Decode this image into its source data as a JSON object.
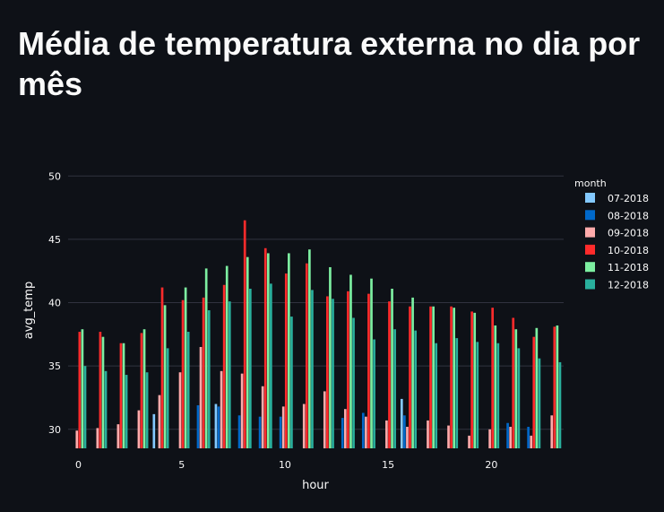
{
  "page": {
    "title": "Média de temperatura externa no dia por mês"
  },
  "chart_data": {
    "type": "bar",
    "xlabel": "hour",
    "ylabel": "avg_temp",
    "xlim": [
      -0.5,
      23.5
    ],
    "ylim": [
      28.5,
      52
    ],
    "x_ticks": [
      0,
      5,
      10,
      15,
      20
    ],
    "y_ticks": [
      30,
      35,
      40,
      45,
      50
    ],
    "grid": true,
    "legend_title": "month",
    "legend_position": "right",
    "x": [
      0,
      1,
      2,
      3,
      4,
      5,
      6,
      7,
      8,
      9,
      10,
      11,
      12,
      13,
      14,
      15,
      16,
      17,
      18,
      19,
      20,
      21,
      22,
      23
    ],
    "series": [
      {
        "name": "07-2018",
        "color": "#83c9ff",
        "values": [
          null,
          null,
          null,
          null,
          31.2,
          null,
          null,
          32.0,
          null,
          null,
          null,
          null,
          null,
          null,
          null,
          null,
          32.4,
          null,
          null,
          null,
          null,
          null,
          null,
          null
        ]
      },
      {
        "name": "08-2018",
        "color": "#0068c9",
        "values": [
          null,
          null,
          null,
          null,
          null,
          null,
          31.9,
          31.8,
          31.1,
          31.0,
          31.0,
          null,
          null,
          30.9,
          31.3,
          null,
          31.1,
          null,
          null,
          null,
          null,
          30.5,
          30.2,
          null
        ]
      },
      {
        "name": "09-2018",
        "color": "#ffabab",
        "values": [
          29.9,
          30.1,
          30.4,
          31.5,
          32.7,
          34.5,
          36.5,
          34.6,
          34.4,
          33.4,
          31.8,
          32.0,
          33.0,
          31.6,
          31.0,
          30.7,
          30.2,
          30.7,
          30.3,
          29.5,
          30.0,
          30.2,
          29.5,
          31.1
        ]
      },
      {
        "name": "10-2018",
        "color": "#ff2b2b",
        "values": [
          37.7,
          37.7,
          36.8,
          37.6,
          41.2,
          40.2,
          40.4,
          41.4,
          46.5,
          44.3,
          42.3,
          43.1,
          40.5,
          40.9,
          40.7,
          40.1,
          39.7,
          39.7,
          39.7,
          39.3,
          39.6,
          38.8,
          37.3,
          38.1
        ]
      },
      {
        "name": "11-2018",
        "color": "#7defa1",
        "values": [
          37.9,
          37.3,
          36.8,
          37.9,
          39.8,
          41.2,
          42.7,
          42.9,
          43.6,
          43.9,
          43.9,
          44.2,
          42.8,
          42.2,
          41.9,
          41.1,
          40.4,
          39.7,
          39.6,
          39.2,
          38.2,
          37.9,
          38.0,
          38.2
        ]
      },
      {
        "name": "12-2018",
        "color": "#29b09d",
        "values": [
          35.0,
          34.6,
          34.3,
          34.5,
          36.4,
          37.7,
          39.4,
          40.1,
          41.1,
          41.5,
          38.9,
          41.0,
          40.3,
          38.8,
          37.1,
          37.9,
          37.8,
          36.8,
          37.2,
          36.9,
          36.8,
          36.4,
          35.6,
          35.3
        ]
      }
    ]
  }
}
